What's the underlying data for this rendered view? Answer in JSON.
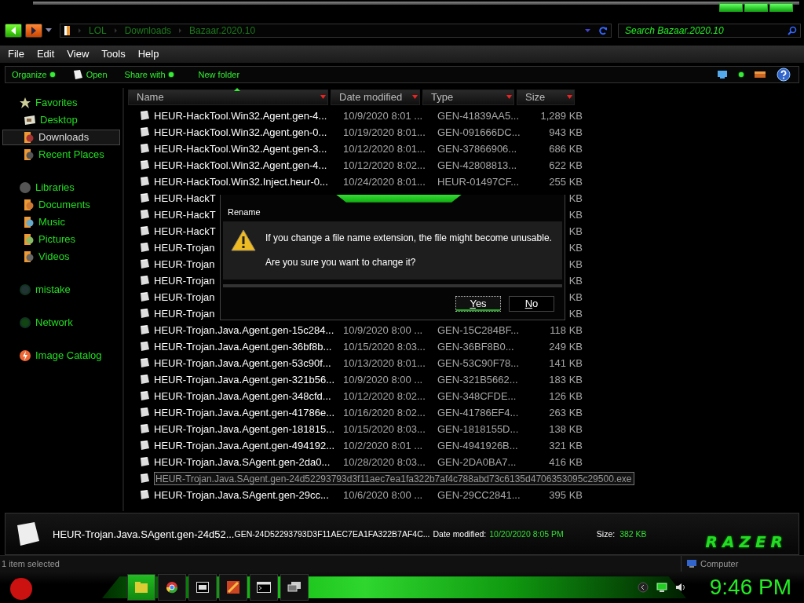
{
  "address_bar": {
    "path": [
      "LOL",
      "Downloads",
      "Bazaar.2020.10"
    ]
  },
  "search": {
    "placeholder": "Search Bazaar.2020.10"
  },
  "menu": [
    "File",
    "Edit",
    "View",
    "Tools",
    "Help"
  ],
  "toolbar": [
    {
      "label": "Organize",
      "kind": "dropdown"
    },
    {
      "label": "Open",
      "kind": "icon"
    },
    {
      "label": "Share with",
      "kind": "dropdown"
    },
    {
      "label": "New folder",
      "kind": "plain"
    }
  ],
  "sidebar": {
    "groups": [
      {
        "label": "Favorites",
        "kind": "star",
        "selected": false,
        "children": [
          {
            "label": "Desktop",
            "kind": "desktop",
            "selected": false
          },
          {
            "label": "Downloads",
            "kind": "downloads",
            "selected": true
          },
          {
            "label": "Recent Places",
            "kind": "recent",
            "selected": false
          }
        ]
      },
      {
        "label": "Libraries",
        "kind": "libraries",
        "selected": false,
        "children": [
          {
            "label": "Documents",
            "kind": "documents",
            "selected": false
          },
          {
            "label": "Music",
            "kind": "music",
            "selected": false
          },
          {
            "label": "Pictures",
            "kind": "pictures",
            "selected": false
          },
          {
            "label": "Videos",
            "kind": "videos",
            "selected": false
          }
        ]
      },
      {
        "label": "mistake",
        "kind": "user",
        "selected": false
      },
      {
        "label": "Network",
        "kind": "network",
        "selected": false
      },
      {
        "label": "Image Catalog",
        "kind": "catalog",
        "selected": false
      }
    ]
  },
  "table": {
    "columns": [
      "Name",
      "Date modified",
      "Type",
      "Size"
    ],
    "rows": [
      {
        "name": "HEUR-HackTool.Win32.Agent.gen-4...",
        "date": "10/9/2020 8:01 ...",
        "type": "GEN-41839AA5...",
        "size": "1,289 KB",
        "selected": false
      },
      {
        "name": "HEUR-HackTool.Win32.Agent.gen-0...",
        "date": "10/19/2020 8:01...",
        "type": "GEN-091666DC...",
        "size": "943 KB",
        "selected": false
      },
      {
        "name": "HEUR-HackTool.Win32.Agent.gen-3...",
        "date": "10/12/2020 8:01...",
        "type": "GEN-37866906...",
        "size": "686 KB",
        "selected": false
      },
      {
        "name": "HEUR-HackTool.Win32.Agent.gen-4...",
        "date": "10/12/2020 8:02...",
        "type": "GEN-42808813...",
        "size": "622 KB",
        "selected": false
      },
      {
        "name": "HEUR-HackTool.Win32.Inject.heur-0...",
        "date": "10/24/2020 8:01...",
        "type": "HEUR-01497CF...",
        "size": "255 KB",
        "selected": false
      },
      {
        "name": "HEUR-HackT",
        "size": "KB",
        "selected": false
      },
      {
        "name": "HEUR-HackT",
        "size": "KB",
        "selected": false
      },
      {
        "name": "HEUR-HackT",
        "size": "KB",
        "selected": false
      },
      {
        "name": "HEUR-Trojan",
        "size": "KB",
        "selected": false
      },
      {
        "name": "HEUR-Trojan",
        "size": "KB",
        "selected": false
      },
      {
        "name": "HEUR-Trojan",
        "size": "KB",
        "selected": false
      },
      {
        "name": "HEUR-Trojan",
        "size": "KB",
        "selected": false
      },
      {
        "name": "HEUR-Trojan",
        "size": "KB",
        "selected": false
      },
      {
        "name": "HEUR-Trojan.Java.Agent.gen-15c284...",
        "date": "10/9/2020 8:00 ...",
        "type": "GEN-15C284BF...",
        "size": "118 KB",
        "selected": false
      },
      {
        "name": "HEUR-Trojan.Java.Agent.gen-36bf8b...",
        "date": "10/15/2020 8:03...",
        "type": "GEN-36BF8B0...",
        "size": "249 KB",
        "selected": false
      },
      {
        "name": "HEUR-Trojan.Java.Agent.gen-53c90f...",
        "date": "10/13/2020 8:01...",
        "type": "GEN-53C90F78...",
        "size": "141 KB",
        "selected": false
      },
      {
        "name": "HEUR-Trojan.Java.Agent.gen-321b56...",
        "date": "10/9/2020 8:00 ...",
        "type": "GEN-321B5662...",
        "size": "183 KB",
        "selected": false
      },
      {
        "name": "HEUR-Trojan.Java.Agent.gen-348cfd...",
        "date": "10/12/2020 8:02...",
        "type": "GEN-348CFDE...",
        "size": "126 KB",
        "selected": false
      },
      {
        "name": "HEUR-Trojan.Java.Agent.gen-41786e...",
        "date": "10/16/2020 8:02...",
        "type": "GEN-41786EF4...",
        "size": "263 KB",
        "selected": false
      },
      {
        "name": "HEUR-Trojan.Java.Agent.gen-181815...",
        "date": "10/15/2020 8:03...",
        "type": "GEN-1818155D...",
        "size": "138 KB",
        "selected": false
      },
      {
        "name": "HEUR-Trojan.Java.Agent.gen-494192...",
        "date": "10/2/2020 8:01 ...",
        "type": "GEN-4941926B...",
        "size": "321 KB",
        "selected": false
      },
      {
        "name": "HEUR-Trojan.Java.SAgent.gen-2da0...",
        "date": "10/28/2020 8:03...",
        "type": "GEN-2DA0BA7...",
        "size": "416 KB",
        "selected": false
      },
      {
        "name": "HEUR-Trojan.Java.SAgent.gen-24d52293793d3f11aec7ea1fa322b7af4c788abd73c6135d4706353095c29500.exe",
        "selected": true
      },
      {
        "name": "HEUR-Trojan.Java.SAgent.gen-29cc...",
        "date": "10/6/2020 8:00 ...",
        "type": "GEN-29CC2841...",
        "size": "395 KB",
        "selected": false
      }
    ]
  },
  "dialog": {
    "title": "Rename",
    "message": "If you change a file name extension, the file might become unusable.",
    "question": "Are you sure you want to change it?",
    "buttons": [
      {
        "label": "Yes",
        "default": true
      },
      {
        "label": "No",
        "default": false
      }
    ]
  },
  "details": {
    "name": "HEUR-Trojan.Java.SAgent.gen-24d52...",
    "type": "GEN-24D52293793D3F11AEC7EA1FA322B7AF4C...",
    "date_label": "Date modified:",
    "date": "10/20/2020 8:05 PM",
    "size_label": "Size:",
    "size": "382 KB",
    "logo": "RAZER"
  },
  "status_bar": {
    "text": "1 item selected",
    "location": "Computer"
  },
  "taskbar": {
    "apps": [
      {
        "kind": "folder",
        "selected": true
      },
      {
        "kind": "browser",
        "selected": false
      },
      {
        "kind": "archive",
        "selected": false
      },
      {
        "kind": "paint",
        "selected": false
      },
      {
        "kind": "console",
        "selected": false
      },
      {
        "kind": "remote",
        "selected": false
      }
    ],
    "clock": "9:46 PM"
  }
}
